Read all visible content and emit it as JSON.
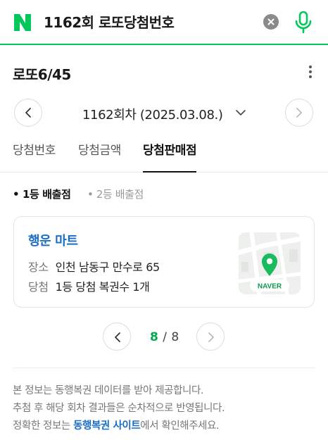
{
  "search": {
    "query": "1162회 로또당첨번호"
  },
  "card": {
    "title": "로또6/45"
  },
  "round": {
    "label": "1162회차 (2025.03.08.)"
  },
  "tabs": [
    {
      "label": "당첨번호"
    },
    {
      "label": "당첨금액"
    },
    {
      "label": "당첨판매점"
    }
  ],
  "subtabs": [
    {
      "label": "1등 배출점"
    },
    {
      "label": "2등 배출점"
    }
  ],
  "store": {
    "name": "행운 마트",
    "address_key": "장소",
    "address": "인천 남동구 만수로 65",
    "result_key": "당첨",
    "result": "1등 당첨 복권수 1개",
    "map_brand": "NAVER"
  },
  "pagination": {
    "current": "8",
    "separator": "/",
    "total": "8"
  },
  "notice": {
    "line1": "본 정보는 동행복권 데이터를 받아 제공합니다.",
    "line2": "추첨 후 해당 회차 결과들은 순차적으로 반영됩니다.",
    "line3_pre": "정확한 정보는 ",
    "line3_link": "동행복권 사이트",
    "line3_post": "에서 확인해주세요."
  },
  "colors": {
    "brand_green": "#03c75a",
    "link_blue": "#1a6dc4"
  }
}
